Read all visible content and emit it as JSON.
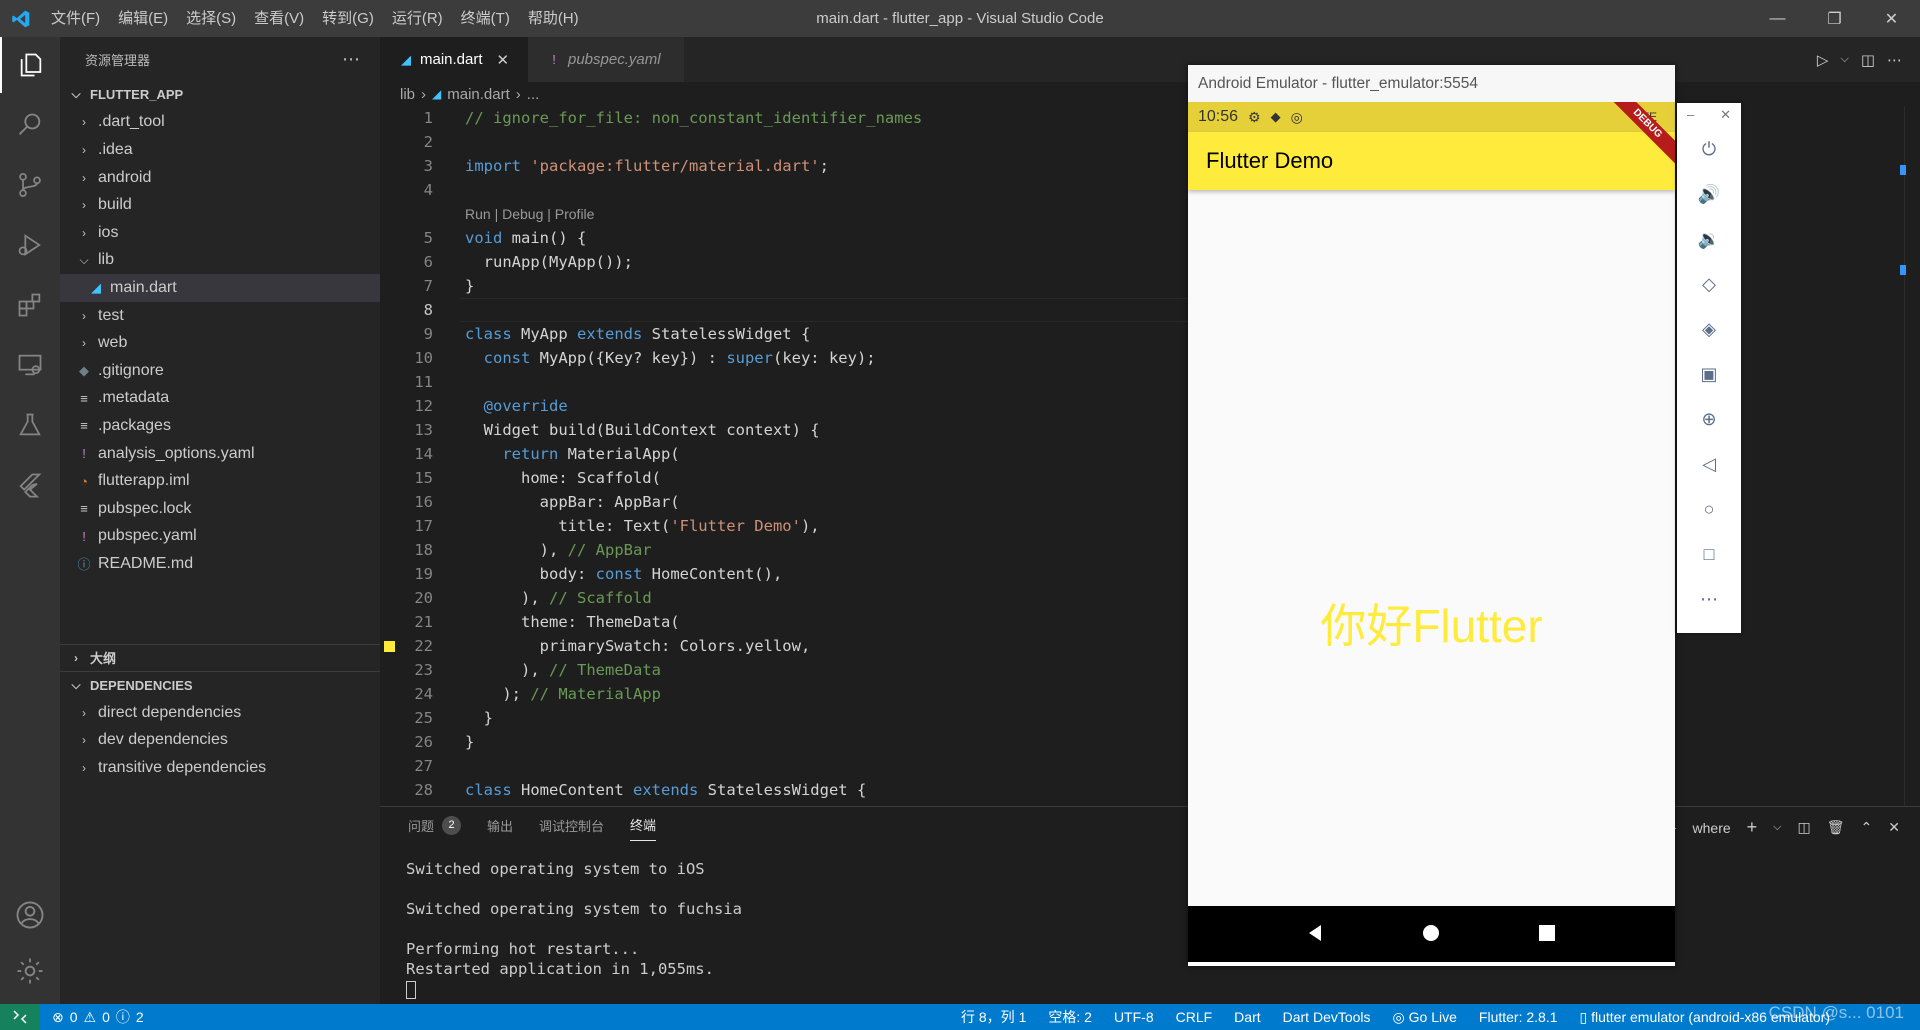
{
  "titlebar": {
    "menus": [
      "文件(F)",
      "编辑(E)",
      "选择(S)",
      "查看(V)",
      "转到(G)",
      "运行(R)",
      "终端(T)",
      "帮助(H)"
    ],
    "window_title": "main.dart - flutter_app - Visual Studio Code"
  },
  "sidebar": {
    "title": "资源管理器",
    "project": "FLUTTER_APP",
    "items": [
      {
        "label": ".dart_tool",
        "type": "folder",
        "depth": 1
      },
      {
        "label": ".idea",
        "type": "folder",
        "depth": 1
      },
      {
        "label": "android",
        "type": "folder",
        "depth": 1
      },
      {
        "label": "build",
        "type": "folder",
        "depth": 1
      },
      {
        "label": "ios",
        "type": "folder",
        "depth": 1
      },
      {
        "label": "lib",
        "type": "folder-open",
        "depth": 1
      },
      {
        "label": "main.dart",
        "type": "dart-file",
        "depth": 2,
        "selected": true
      },
      {
        "label": "test",
        "type": "folder",
        "depth": 1
      },
      {
        "label": "web",
        "type": "folder",
        "depth": 1
      },
      {
        "label": ".gitignore",
        "type": "git-file",
        "depth": 1
      },
      {
        "label": ".metadata",
        "type": "text-file",
        "depth": 1
      },
      {
        "label": ".packages",
        "type": "text-file",
        "depth": 1
      },
      {
        "label": "analysis_options.yaml",
        "type": "yaml-file",
        "depth": 1
      },
      {
        "label": "flutterapp.iml",
        "type": "rss-file",
        "depth": 1
      },
      {
        "label": "pubspec.lock",
        "type": "text-file",
        "depth": 1
      },
      {
        "label": "pubspec.yaml",
        "type": "yaml-file",
        "depth": 1
      },
      {
        "label": "README.md",
        "type": "info-file",
        "depth": 1
      }
    ],
    "outline": "大纲",
    "dependencies": "DEPENDENCIES",
    "dep_items": [
      "direct dependencies",
      "dev dependencies",
      "transitive dependencies"
    ]
  },
  "tabs": [
    {
      "label": "main.dart",
      "active": true
    },
    {
      "label": "pubspec.yaml",
      "active": false
    }
  ],
  "breadcrumb": {
    "folder": "lib",
    "file": "main.dart",
    "more": "..."
  },
  "editor": {
    "codelens": "Run | Debug | Profile",
    "lines": [
      {
        "n": "1",
        "html": "<span class='c'>// ignore_for_file: non_constant_identifier_names</span>"
      },
      {
        "n": "2",
        "html": ""
      },
      {
        "n": "3",
        "html": "<span class='k'>import</span> <span class='s'>'package:flutter/material.dart'</span>;"
      },
      {
        "n": "4",
        "html": ""
      },
      {
        "n": "5",
        "html": "<span class='k'>void</span> main() {"
      },
      {
        "n": "6",
        "html": "  runApp(MyApp());"
      },
      {
        "n": "7",
        "html": "}"
      },
      {
        "n": "8",
        "html": ""
      },
      {
        "n": "9",
        "html": "<span class='k'>class</span> MyApp <span class='k'>extends</span> StatelessWidget {"
      },
      {
        "n": "10",
        "html": "  <span class='k'>const</span> MyApp({Key? key}) : <span class='k'>super</span>(key: key);"
      },
      {
        "n": "11",
        "html": ""
      },
      {
        "n": "12",
        "html": "  <span class='k'>@override</span>"
      },
      {
        "n": "13",
        "html": "  Widget build(BuildContext context) {"
      },
      {
        "n": "14",
        "html": "    <span class='k'>return</span> MaterialApp("
      },
      {
        "n": "15",
        "html": "      home: Scaffold("
      },
      {
        "n": "16",
        "html": "        appBar: AppBar("
      },
      {
        "n": "17",
        "html": "          title: Text(<span class='s'>'Flutter Demo'</span>),"
      },
      {
        "n": "18",
        "html": "        ), <span class='c'>// AppBar</span>"
      },
      {
        "n": "19",
        "html": "        body: <span class='k'>const</span> HomeContent(),"
      },
      {
        "n": "20",
        "html": "      ), <span class='c'>// Scaffold</span>"
      },
      {
        "n": "21",
        "html": "      theme: ThemeData("
      },
      {
        "n": "22",
        "html": "        primarySwatch: Colors.yellow,"
      },
      {
        "n": "23",
        "html": "      ), <span class='c'>// ThemeData</span>"
      },
      {
        "n": "24",
        "html": "    ); <span class='c'>// MaterialApp</span>"
      },
      {
        "n": "25",
        "html": "  }"
      },
      {
        "n": "26",
        "html": "}"
      },
      {
        "n": "27",
        "html": ""
      },
      {
        "n": "28",
        "html": "<span class='k'>class</span> HomeContent <span class='k'>extends</span> StatelessWidget {"
      }
    ],
    "current_line": "8",
    "color_marker": "#ffeb3b"
  },
  "panel": {
    "tabs": [
      {
        "label": "问题",
        "badge": "2"
      },
      {
        "label": "输出"
      },
      {
        "label": "调试控制台"
      },
      {
        "label": "终端",
        "active": true
      }
    ],
    "terminal_lines": [
      "Switched operating system to iOS",
      "",
      "Switched operating system to fuchsia",
      "",
      "Performing hot restart...",
      "Restarted application in 1,055ms."
    ],
    "shell_label": "where"
  },
  "statusbar": {
    "errors": "0",
    "warnings": "0",
    "infos": "2",
    "position": "行 8，列 1",
    "spaces": "空格: 2",
    "encoding": "UTF-8",
    "eol": "CRLF",
    "language": "Dart",
    "devtools": "Dart DevTools",
    "golive": "Go Live",
    "flutter": "Flutter: 2.8.1",
    "device": "flutter emulator (android-x86 emulator)"
  },
  "emulator": {
    "title": "Android Emulator - flutter_emulator:5554",
    "time": "10:56",
    "network": "LTE",
    "appbar_title": "Flutter Demo",
    "body_text": "你好Flutter",
    "debug_banner": "DEBUG",
    "tools": [
      "power-icon",
      "volume-up-icon",
      "volume-down-icon",
      "rotate-left-icon",
      "rotate-right-icon",
      "camera-icon",
      "zoom-icon",
      "back-icon",
      "home-icon",
      "overview-icon",
      "more-icon"
    ]
  },
  "watermark": "CSDN @s... 0101",
  "colors": {
    "accent": "#007acc",
    "appbar": "#ffeb3b",
    "remote": "#16825d"
  }
}
